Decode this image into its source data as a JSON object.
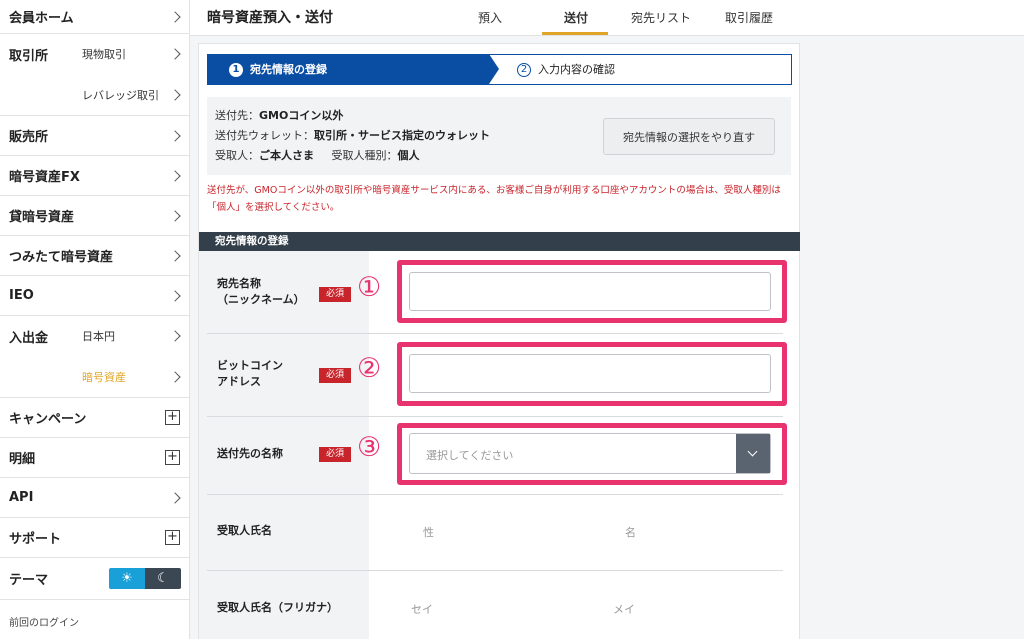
{
  "sidebar": {
    "items": [
      {
        "label": "会員ホーム"
      },
      {
        "label": "取引所",
        "sub": "現物取引"
      },
      {
        "sub": "レバレッジ取引"
      },
      {
        "label": "販売所"
      },
      {
        "label": "暗号資産FX"
      },
      {
        "label": "貸暗号資産"
      },
      {
        "label": "つみたて暗号資産"
      },
      {
        "label": "IEO"
      },
      {
        "label": "入出金",
        "sub": "日本円"
      },
      {
        "sub": "暗号資産"
      },
      {
        "label": "キャンペーン"
      },
      {
        "label": "明細"
      },
      {
        "label": "API"
      },
      {
        "label": "サポート"
      },
      {
        "label": "テーマ"
      }
    ],
    "last_login": "前回のログイン",
    "theme_light_icon": "☀",
    "theme_dark_icon": "☾",
    "plus_symbol": "+",
    "accent_color": "#e0a526"
  },
  "header": {
    "title": "暗号資産預入・送付",
    "tabs": [
      {
        "label": "預入"
      },
      {
        "label": "送付",
        "active": true
      },
      {
        "label": "宛先リスト"
      },
      {
        "label": "取引履歴"
      }
    ]
  },
  "steps": [
    {
      "num": "1",
      "label": "宛先情報の登録",
      "active": true
    },
    {
      "num": "2",
      "label": "入力内容の確認"
    }
  ],
  "info": {
    "dest_label": "送付先：",
    "dest_value": "GMOコイン以外",
    "wallet_label": "送付先ウォレット：",
    "wallet_value": "取引所・サービス指定のウォレット",
    "recipient_label": "受取人：",
    "recipient_value": "ご本人さま",
    "type_label": "受取人種別：",
    "type_value": "個人",
    "reselect_button": "宛先情報の選択をやり直す"
  },
  "warning": "送付先が、GMOコイン以外の取引所や暗号資産サービス内にある、お客様ご自身が利用する口座やアカウントの場合は、受取人種別は「個人」を選択してください。",
  "form": {
    "section_title": "宛先情報の登録",
    "required_label": "必須",
    "fields": [
      {
        "label1": "宛先名称",
        "label2": "（ニックネーム）",
        "marker": "①",
        "value": ""
      },
      {
        "label1": "ビットコイン",
        "label2": "アドレス",
        "marker": "②",
        "value": ""
      },
      {
        "label1": "送付先の名称",
        "marker": "③",
        "placeholder": "選択してください"
      }
    ],
    "name_label": "受取人氏名",
    "name_last_ph": "性",
    "name_first_ph": "名",
    "kana_label": "受取人氏名（フリガナ）",
    "kana_last_ph": "セイ",
    "kana_first_ph": "メイ"
  },
  "colors": {
    "brand_blue": "#0a4ea3",
    "highlight_pink": "#e8336f",
    "required_red": "#c8242b"
  }
}
